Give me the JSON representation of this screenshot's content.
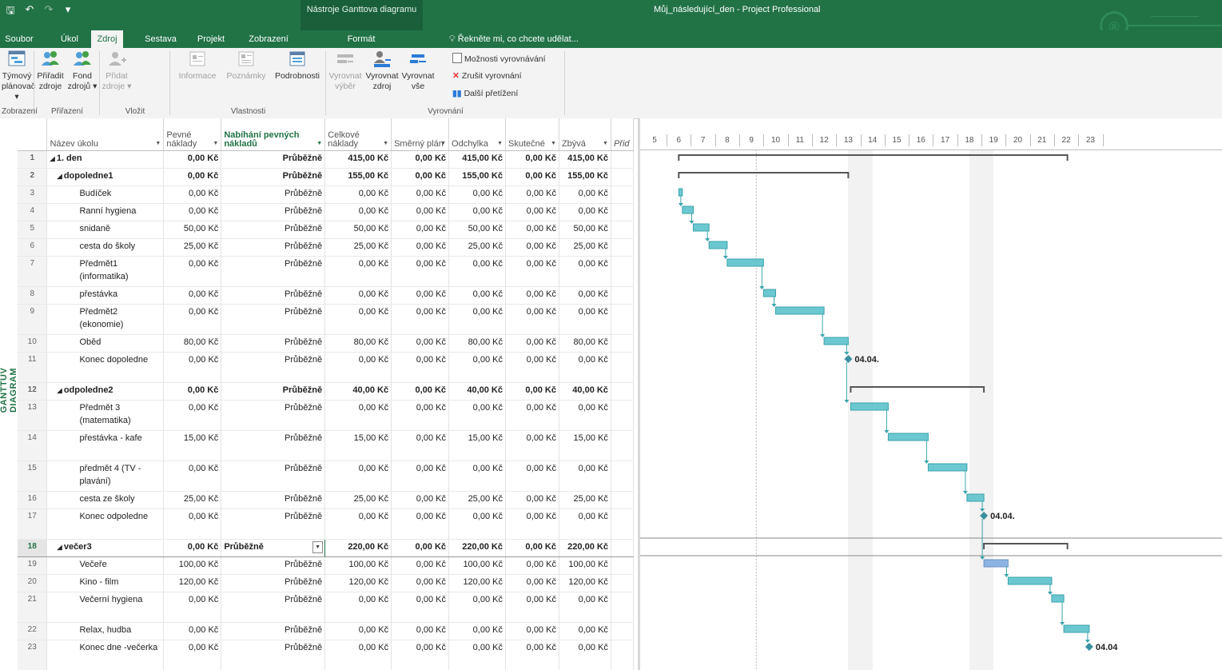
{
  "titlebar": {
    "qat": [
      "🖫",
      "↶",
      "↷",
      "▾"
    ],
    "context_label": "Nástroje Ganttova diagramu",
    "title": "Můj_následující_den - Project Professional"
  },
  "tabs": [
    {
      "label": "Soubor",
      "active": false
    },
    {
      "label": "Úkol",
      "active": false
    },
    {
      "label": "Zdroj",
      "active": true
    },
    {
      "label": "Sestava",
      "active": false
    },
    {
      "label": "Projekt",
      "active": false
    },
    {
      "label": "Zobrazení",
      "active": false
    },
    {
      "label": "Formát",
      "active": false
    }
  ],
  "tellme": "Řekněte mi, co chcete udělat...",
  "ribbon": {
    "tymovy": "Týmový plánovač ▾",
    "priradit": "Přiřadit zdroje",
    "fond": "Fond zdrojů ▾",
    "pridat": "Přidat zdroje ▾",
    "informace": "Informace",
    "poznamky": "Poznámky",
    "podrobnosti": "Podrobnosti",
    "vyrovnat_vyber": "Vyrovnat výběr",
    "vyrovnat_zdroj": "Vyrovnat zdroj",
    "vyrovnat_vse": "Vyrovnat vše",
    "moznosti": "Možnosti vyrovnávání",
    "zrusit": "Zrušit vyrovnání",
    "dalsi": "Další přetížení",
    "groups": [
      "Zobrazení",
      "Přiřazení",
      "Vložit",
      "Vlastnosti",
      "Vyrovnání"
    ]
  },
  "side_label": "GANTTŮV DIAGRAM",
  "columns": {
    "name": "Název úkolu",
    "fixed": "Pevné náklady",
    "accrual": "Nabíhání pevných nákladů",
    "total": "Celkové náklady",
    "baseline": "Směrný plán",
    "variance": "Odchylka",
    "actual": "Skutečné",
    "remaining": "Zbývá",
    "add": "Přid"
  },
  "tasks": [
    {
      "id": "1",
      "name": "1. den",
      "summary": true,
      "level": 0,
      "fixed": "0,00 Kč",
      "accrual": "Průběžně",
      "total": "415,00 Kč",
      "baseline": "0,00 Kč",
      "variance": "415,00 Kč",
      "actual": "0,00 Kč",
      "remaining": "415,00 Kč",
      "h": 22
    },
    {
      "id": "2",
      "name": "dopoledne1",
      "summary": true,
      "level": 1,
      "fixed": "0,00 Kč",
      "accrual": "Průběžně",
      "total": "155,00 Kč",
      "baseline": "0,00 Kč",
      "variance": "155,00 Kč",
      "actual": "0,00 Kč",
      "remaining": "155,00 Kč",
      "h": 22
    },
    {
      "id": "3",
      "name": "Budíček",
      "summary": false,
      "level": 2,
      "fixed": "0,00 Kč",
      "accrual": "Průběžně",
      "total": "0,00 Kč",
      "baseline": "0,00 Kč",
      "variance": "0,00 Kč",
      "actual": "0,00 Kč",
      "remaining": "0,00 Kč",
      "h": 22
    },
    {
      "id": "4",
      "name": "Ranní hygiena",
      "summary": false,
      "level": 2,
      "fixed": "0,00 Kč",
      "accrual": "Průběžně",
      "total": "0,00 Kč",
      "baseline": "0,00 Kč",
      "variance": "0,00 Kč",
      "actual": "0,00 Kč",
      "remaining": "0,00 Kč",
      "h": 22
    },
    {
      "id": "5",
      "name": "snidaně",
      "summary": false,
      "level": 2,
      "fixed": "50,00 Kč",
      "accrual": "Průběžně",
      "total": "50,00 Kč",
      "baseline": "0,00 Kč",
      "variance": "50,00 Kč",
      "actual": "0,00 Kč",
      "remaining": "50,00 Kč",
      "h": 22
    },
    {
      "id": "6",
      "name": "cesta do školy",
      "summary": false,
      "level": 2,
      "fixed": "25,00 Kč",
      "accrual": "Průběžně",
      "total": "25,00 Kč",
      "baseline": "0,00 Kč",
      "variance": "25,00 Kč",
      "actual": "0,00 Kč",
      "remaining": "25,00 Kč",
      "h": 22
    },
    {
      "id": "7",
      "name": "Předmět1 (informatika)",
      "summary": false,
      "level": 2,
      "fixed": "0,00 Kč",
      "accrual": "Průběžně",
      "total": "0,00 Kč",
      "baseline": "0,00 Kč",
      "variance": "0,00 Kč",
      "actual": "0,00 Kč",
      "remaining": "0,00 Kč",
      "h": 38
    },
    {
      "id": "8",
      "name": "přestávka",
      "summary": false,
      "level": 2,
      "fixed": "0,00 Kč",
      "accrual": "Průběžně",
      "total": "0,00 Kč",
      "baseline": "0,00 Kč",
      "variance": "0,00 Kč",
      "actual": "0,00 Kč",
      "remaining": "0,00 Kč",
      "h": 22
    },
    {
      "id": "9",
      "name": "Předmět2 (ekonomie)",
      "summary": false,
      "level": 2,
      "fixed": "0,00 Kč",
      "accrual": "Průběžně",
      "total": "0,00 Kč",
      "baseline": "0,00 Kč",
      "variance": "0,00 Kč",
      "actual": "0,00 Kč",
      "remaining": "0,00 Kč",
      "h": 38
    },
    {
      "id": "10",
      "name": "Oběd",
      "summary": false,
      "level": 2,
      "fixed": "80,00 Kč",
      "accrual": "Průběžně",
      "total": "80,00 Kč",
      "baseline": "0,00 Kč",
      "variance": "80,00 Kč",
      "actual": "0,00 Kč",
      "remaining": "80,00 Kč",
      "h": 22
    },
    {
      "id": "11",
      "name": "Konec dopoledne",
      "summary": false,
      "level": 2,
      "fixed": "0,00 Kč",
      "accrual": "Průběžně",
      "total": "0,00 Kč",
      "baseline": "0,00 Kč",
      "variance": "0,00 Kč",
      "actual": "0,00 Kč",
      "remaining": "0,00 Kč",
      "h": 38
    },
    {
      "id": "12",
      "name": "odpoledne2",
      "summary": true,
      "level": 1,
      "fixed": "0,00 Kč",
      "accrual": "Průběžně",
      "total": "40,00 Kč",
      "baseline": "0,00 Kč",
      "variance": "40,00 Kč",
      "actual": "0,00 Kč",
      "remaining": "40,00 Kč",
      "h": 22
    },
    {
      "id": "13",
      "name": "Předmět 3 (matematika)",
      "summary": false,
      "level": 2,
      "fixed": "0,00 Kč",
      "accrual": "Průběžně",
      "total": "0,00 Kč",
      "baseline": "0,00 Kč",
      "variance": "0,00 Kč",
      "actual": "0,00 Kč",
      "remaining": "0,00 Kč",
      "h": 38
    },
    {
      "id": "14",
      "name": "přestávka - kafe",
      "summary": false,
      "level": 2,
      "fixed": "15,00 Kč",
      "accrual": "Průběžně",
      "total": "15,00 Kč",
      "baseline": "0,00 Kč",
      "variance": "15,00 Kč",
      "actual": "0,00 Kč",
      "remaining": "15,00 Kč",
      "h": 38
    },
    {
      "id": "15",
      "name": "předmět 4 (TV - plavání)",
      "summary": false,
      "level": 2,
      "fixed": "0,00 Kč",
      "accrual": "Průběžně",
      "total": "0,00 Kč",
      "baseline": "0,00 Kč",
      "variance": "0,00 Kč",
      "actual": "0,00 Kč",
      "remaining": "0,00 Kč",
      "h": 38
    },
    {
      "id": "16",
      "name": "cesta ze školy",
      "summary": false,
      "level": 2,
      "fixed": "25,00 Kč",
      "accrual": "Průběžně",
      "total": "25,00 Kč",
      "baseline": "0,00 Kč",
      "variance": "25,00 Kč",
      "actual": "0,00 Kč",
      "remaining": "25,00 Kč",
      "h": 22
    },
    {
      "id": "17",
      "name": "Konec odpoledne",
      "summary": false,
      "level": 2,
      "fixed": "0,00 Kč",
      "accrual": "Průběžně",
      "total": "0,00 Kč",
      "baseline": "0,00 Kč",
      "variance": "0,00 Kč",
      "actual": "0,00 Kč",
      "remaining": "0,00 Kč",
      "h": 38
    },
    {
      "id": "18",
      "name": "večer3",
      "summary": true,
      "level": 1,
      "fixed": "0,00 Kč",
      "accrual": "Průběžně",
      "total": "220,00 Kč",
      "baseline": "0,00 Kč",
      "variance": "220,00 Kč",
      "actual": "0,00 Kč",
      "remaining": "220,00 Kč",
      "h": 22,
      "selected": true
    },
    {
      "id": "19",
      "name": "Večeře",
      "summary": false,
      "level": 2,
      "fixed": "100,00 Kč",
      "accrual": "Průběžně",
      "total": "100,00 Kč",
      "baseline": "0,00 Kč",
      "variance": "100,00 Kč",
      "actual": "0,00 Kč",
      "remaining": "100,00 Kč",
      "h": 22
    },
    {
      "id": "20",
      "name": "Kino - film",
      "summary": false,
      "level": 2,
      "fixed": "120,00 Kč",
      "accrual": "Průběžně",
      "total": "120,00 Kč",
      "baseline": "0,00 Kč",
      "variance": "120,00 Kč",
      "actual": "0,00 Kč",
      "remaining": "120,00 Kč",
      "h": 22
    },
    {
      "id": "21",
      "name": "Večerní hygiena",
      "summary": false,
      "level": 2,
      "fixed": "0,00 Kč",
      "accrual": "Průběžně",
      "total": "0,00 Kč",
      "baseline": "0,00 Kč",
      "variance": "0,00 Kč",
      "actual": "0,00 Kč",
      "remaining": "0,00 Kč",
      "h": 38
    },
    {
      "id": "22",
      "name": "Relax, hudba",
      "summary": false,
      "level": 2,
      "fixed": "0,00 Kč",
      "accrual": "Průběžně",
      "total": "0,00 Kč",
      "baseline": "0,00 Kč",
      "variance": "0,00 Kč",
      "actual": "0,00 Kč",
      "remaining": "0,00 Kč",
      "h": 22
    },
    {
      "id": "23",
      "name": "Konec dne -večerka",
      "summary": false,
      "level": 2,
      "fixed": "0,00 Kč",
      "accrual": "Průběžně",
      "total": "0,00 Kč",
      "baseline": "0,00 Kč",
      "variance": "0,00 Kč",
      "actual": "0,00 Kč",
      "remaining": "0,00 Kč",
      "h": 38
    }
  ],
  "gantt": {
    "timescale": [
      "5",
      "6",
      "7",
      "8",
      "9",
      "10",
      "11",
      "12",
      "13",
      "14",
      "15",
      "16",
      "17",
      "18",
      "19",
      "20",
      "21",
      "22",
      "23"
    ],
    "bars": [
      {
        "row": 0,
        "type": "summary",
        "start": 6,
        "end": 22.05
      },
      {
        "row": 1,
        "type": "summary",
        "start": 6,
        "end": 13
      },
      {
        "row": 2,
        "type": "task",
        "start": 6,
        "end": 6.15
      },
      {
        "row": 3,
        "type": "task",
        "start": 6.15,
        "end": 6.6
      },
      {
        "row": 4,
        "type": "task",
        "start": 6.6,
        "end": 7.25
      },
      {
        "row": 5,
        "type": "task",
        "start": 7.25,
        "end": 8
      },
      {
        "row": 6,
        "type": "task",
        "start": 8,
        "end": 9.5
      },
      {
        "row": 7,
        "type": "task",
        "start": 9.5,
        "end": 10
      },
      {
        "row": 8,
        "type": "task",
        "start": 10,
        "end": 12
      },
      {
        "row": 9,
        "type": "task",
        "start": 12,
        "end": 13
      },
      {
        "row": 10,
        "type": "milestone",
        "at": 13,
        "label": "04.04."
      },
      {
        "row": 11,
        "type": "summary",
        "start": 13.1,
        "end": 18.6
      },
      {
        "row": 12,
        "type": "task",
        "start": 13.1,
        "end": 14.65
      },
      {
        "row": 13,
        "type": "task",
        "start": 14.65,
        "end": 16.3
      },
      {
        "row": 14,
        "type": "task",
        "start": 16.3,
        "end": 17.9
      },
      {
        "row": 15,
        "type": "task",
        "start": 17.9,
        "end": 18.6
      },
      {
        "row": 16,
        "type": "milestone",
        "at": 18.6,
        "label": "04.04."
      },
      {
        "row": 17,
        "type": "summary",
        "start": 18.6,
        "end": 22.05
      },
      {
        "row": 18,
        "type": "task",
        "start": 18.6,
        "end": 19.6,
        "selected": true
      },
      {
        "row": 19,
        "type": "task",
        "start": 19.6,
        "end": 21.4
      },
      {
        "row": 20,
        "type": "task",
        "start": 21.4,
        "end": 21.9
      },
      {
        "row": 21,
        "type": "task",
        "start": 21.9,
        "end": 22.95
      },
      {
        "row": 22,
        "type": "milestone",
        "at": 22.95,
        "label": "04.04"
      }
    ]
  },
  "colors": {
    "accent": "#217346",
    "task_bar": "#6cc8d0",
    "task_bar_edge": "#3aa3ad",
    "selected_bar": "#8db3e2",
    "summary": "#555555",
    "milestone": "#3b8fa0",
    "shade": "#f2f2f2"
  }
}
